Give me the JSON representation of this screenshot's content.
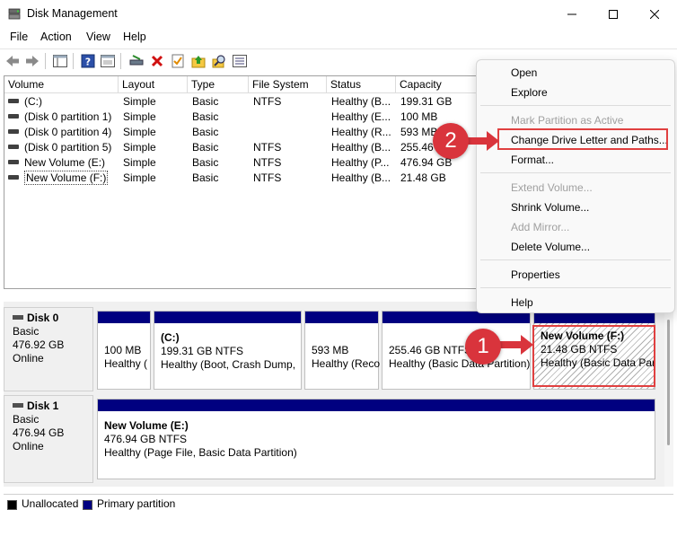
{
  "window": {
    "title": "Disk Management"
  },
  "menu": [
    "File",
    "Action",
    "View",
    "Help"
  ],
  "list": {
    "columns": [
      "Volume",
      "Layout",
      "Type",
      "File System",
      "Status",
      "Capacity"
    ],
    "rows": [
      [
        "(C:)",
        "Simple",
        "Basic",
        "NTFS",
        "Healthy (B...",
        "199.31 GB"
      ],
      [
        "(Disk 0 partition 1)",
        "Simple",
        "Basic",
        "",
        "Healthy (E...",
        "100 MB"
      ],
      [
        "(Disk 0 partition 4)",
        "Simple",
        "Basic",
        "",
        "Healthy (R...",
        "593 MB"
      ],
      [
        "(Disk 0 partition 5)",
        "Simple",
        "Basic",
        "NTFS",
        "Healthy (B...",
        "255.46"
      ],
      [
        "New Volume (E:)",
        "Simple",
        "Basic",
        "NTFS",
        "Healthy (P...",
        "476.94 GB"
      ],
      [
        "New Volume (F:)",
        "Simple",
        "Basic",
        "NTFS",
        "Healthy (B...",
        "21.48 GB"
      ]
    ]
  },
  "disks": [
    {
      "name": "Disk 0",
      "type": "Basic",
      "size": "476.92 GB",
      "state": "Online",
      "partitions": [
        {
          "title": "",
          "size": "100 MB",
          "status": "Healthy ("
        },
        {
          "title": "(C:)",
          "size": "199.31 GB NTFS",
          "status": "Healthy (Boot, Crash Dump,"
        },
        {
          "title": "",
          "size": "593 MB",
          "status": "Healthy (Reco"
        },
        {
          "title": "",
          "size": "255.46 GB NTFS",
          "status": "Healthy (Basic Data Partition)"
        },
        {
          "title": "New Volume  (F:)",
          "size": "21.48 GB NTFS",
          "status": "Healthy (Basic Data Par"
        }
      ]
    },
    {
      "name": "Disk 1",
      "type": "Basic",
      "size": "476.94 GB",
      "state": "Online",
      "partitions": [
        {
          "title": "New Volume  (E:)",
          "size": "476.94 GB NTFS",
          "status": "Healthy (Page File, Basic Data Partition)"
        }
      ]
    }
  ],
  "legend": {
    "unallocated": "Unallocated",
    "primary": "Primary partition"
  },
  "context_menu": {
    "open": "Open",
    "explore": "Explore",
    "mark_active": "Mark Partition as Active",
    "change_letter": "Change Drive Letter and Paths...",
    "format": "Format...",
    "extend": "Extend Volume...",
    "shrink": "Shrink Volume...",
    "add_mirror": "Add Mirror...",
    "delete": "Delete Volume...",
    "properties": "Properties",
    "help": "Help"
  },
  "annotations": {
    "step1": "1",
    "step2": "2"
  },
  "colors": {
    "partition_bar": "#000080",
    "highlight": "#e04040",
    "badge": "#d9343c"
  }
}
